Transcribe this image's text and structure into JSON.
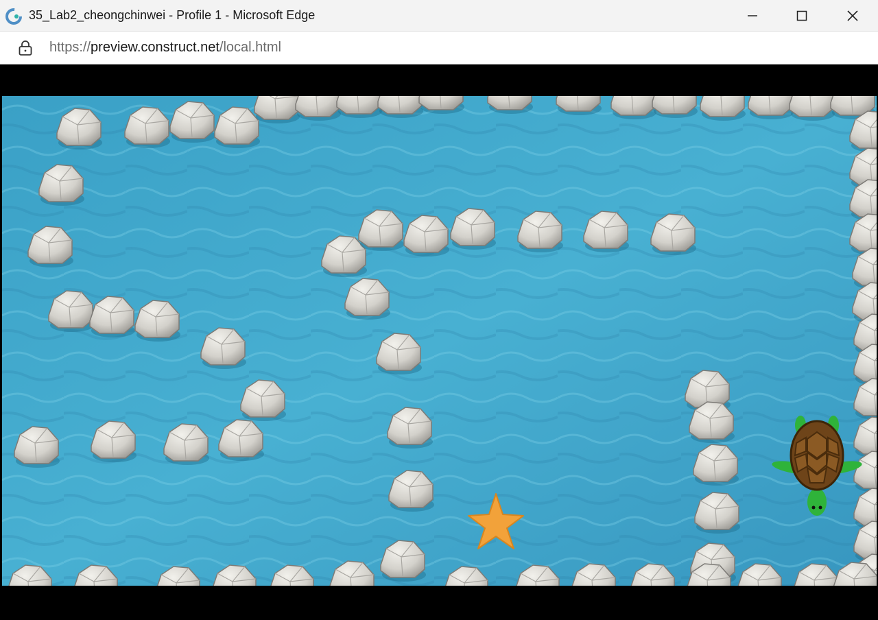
{
  "window": {
    "title": "35_Lab2_cheongchinwei - Profile 1 - Microsoft Edge",
    "minimize_icon": "minimize-icon",
    "maximize_icon": "maximize-icon",
    "close_icon": "close-icon"
  },
  "address_bar": {
    "scheme": "https://",
    "host": "preview.construct.net",
    "path": "/local.html",
    "lock_icon": "lock-icon"
  },
  "colors": {
    "water": "#3fa7c9",
    "rock": "#d8d6d0",
    "starfish": "#f2a23a",
    "turtle_shell": "#7a4a1f",
    "turtle_skin": "#2fb33a"
  }
}
